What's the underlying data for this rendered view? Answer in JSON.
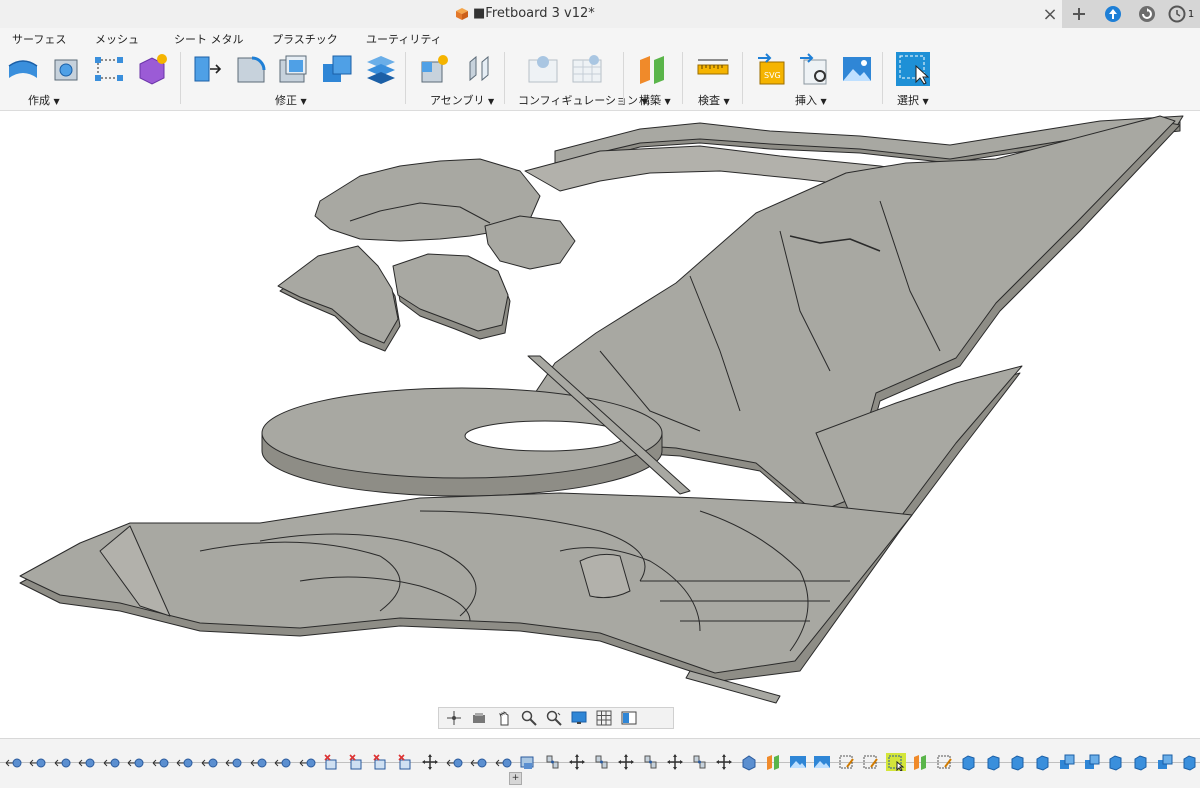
{
  "window": {
    "title": "■Fretboard 3 v12*",
    "close_symbol": "×",
    "right_buttons": [
      "add-tab-icon",
      "upload-icon",
      "online-status-icon",
      "job-status-icon"
    ],
    "job_count": "1"
  },
  "ribbon": {
    "tabs": [
      "サーフェス",
      "メッシュ",
      "シート メタル",
      "プラスチック",
      "ユーティリティ"
    ],
    "groups": {
      "create": "作成",
      "modify": "修正",
      "assemble": "アセンブリ",
      "configure": "コンフィギュレーション",
      "construct": "構築",
      "inspect": "検査",
      "insert": "挿入",
      "select": "選択"
    },
    "accent_color": "#1e88e5",
    "select_highlight": "#1e90d6"
  },
  "viewport": {
    "background": "#ffffff",
    "model_color": "#a8a8a2",
    "model_side_color": "#8e8d86",
    "navbar_icons": [
      "orbit-icon",
      "look-at-icon",
      "pan-icon",
      "zoom-icon",
      "fit-icon",
      "display-settings-icon",
      "grid-icon",
      "viewports-icon"
    ]
  },
  "timeline": {
    "plus_symbol": "+",
    "highlight_color": "#d4e63a"
  }
}
